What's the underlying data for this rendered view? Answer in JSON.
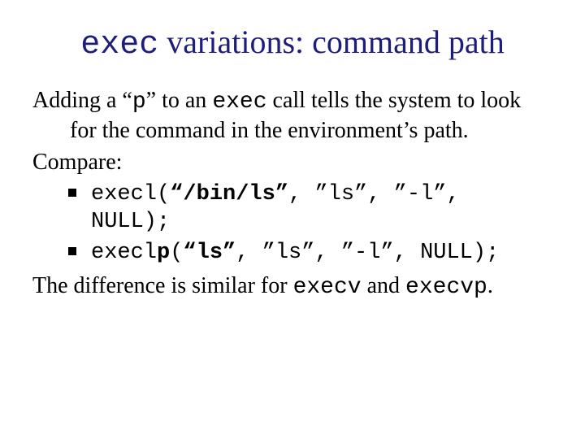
{
  "title": {
    "code": "exec",
    "rest": " variations: command path"
  },
  "para1": {
    "t1": "Adding a “",
    "code1": "p",
    "t2": "” to an ",
    "code2": "exec",
    "t3": " call tells the system to look for the command in the environment’s path."
  },
  "para2": "Compare:",
  "bullets": [
    {
      "pre": "execl(",
      "bold1": "“/bin/ls”",
      "post1": ", ”ls”, ”-l”,",
      "post2": "NULL);"
    },
    {
      "pre": "execl",
      "boldp": "p",
      "post1": "(",
      "bold2": "“ls”",
      "post2": ", ”ls”, ”-l”, NULL);"
    }
  ],
  "para3": {
    "t1": "The difference is similar for ",
    "code1": "execv",
    "t2": " and ",
    "code2": "execvp",
    "t3": "."
  }
}
